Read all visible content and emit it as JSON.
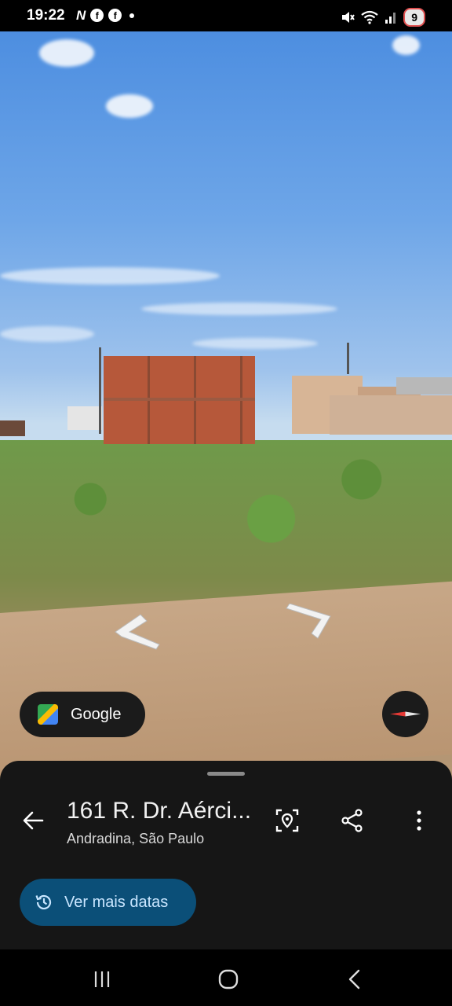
{
  "status": {
    "time": "19:22",
    "notification_icons": [
      "netflix-icon",
      "facebook-icon",
      "facebook-icon"
    ],
    "battery": "9"
  },
  "streetview": {
    "google_label": "Google",
    "nav_arrows": [
      "left-arrow",
      "right-arrow"
    ]
  },
  "sheet": {
    "title": "161 R. Dr. Aérci...",
    "subtitle": "Andradina, São Paulo",
    "dates_button": "Ver mais datas",
    "actions": [
      "view-icon",
      "share-icon",
      "more-icon"
    ]
  },
  "colors": {
    "sheet_bg": "#161616",
    "dates_button_bg": "#0b4f78",
    "dates_button_text": "#c9e6ff",
    "compass_red": "#e53935"
  }
}
